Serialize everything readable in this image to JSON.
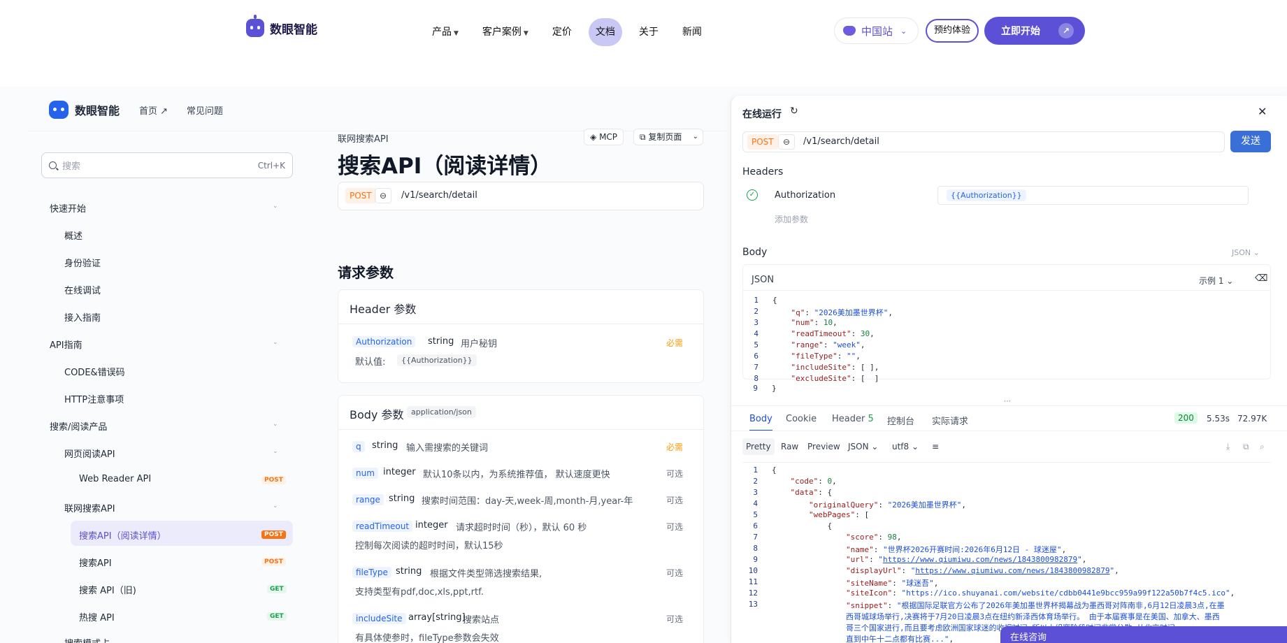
{
  "topnav": {
    "brand": "数眼智能",
    "items": [
      "产品",
      "客户案例",
      "定价",
      "文档",
      "关于",
      "新闻"
    ],
    "active": "文档",
    "site": "中国站",
    "demo": "预约体验",
    "start": "立即开始"
  },
  "docheader": {
    "brand": "数眼智能",
    "home": "首页 ↗",
    "faq": "常见问题"
  },
  "search": {
    "placeholder": "搜索",
    "shortcut": "Ctrl+K"
  },
  "sidebar": {
    "quick": "快速开始",
    "overview": "概述",
    "auth": "身份验证",
    "online": "在线调试",
    "guide": "接入指南",
    "apiguide": "API指南",
    "codes": "CODE&错误码",
    "http": "HTTP注意事项",
    "product": "搜索/阅读产品",
    "webread": "网页阅读API",
    "webreader": "Web Reader API",
    "netsearch": "联网搜索API",
    "detail": "搜索API（阅读详情）",
    "searchapi": "搜索API",
    "searchold": "搜索 API（旧)",
    "hot": "热搜 API",
    "more": "搜索模式占",
    "post": "POST",
    "get": "GET"
  },
  "main": {
    "crumb": "联网搜索API",
    "mcp": "MCP",
    "copy": "复制页面",
    "title": "搜索API（阅读详情）",
    "method": "POST",
    "endpoint": "/v1/search/detail",
    "reqparams": "请求参数",
    "headerparams": "Header 参数",
    "auth_name": "Authorization",
    "auth_type": "string",
    "auth_desc": "用户秘钥",
    "required": "必需",
    "optional": "可选",
    "default_label": "默认值:",
    "default_val": "{{Authorization}}",
    "bodyparams": "Body 参数",
    "content_type": "application/json",
    "params": [
      {
        "name": "q",
        "type": "string",
        "desc": "输入需搜索的关键词",
        "req": "必需"
      },
      {
        "name": "num",
        "type": "integer",
        "desc": "默认10条以内，为系统推荐值， 默认速度更快",
        "req": "可选"
      },
      {
        "name": "range",
        "type": "string",
        "desc": "搜索时间范围：day-天,week-周,month-月,year-年",
        "req": "可选"
      },
      {
        "name": "readTimeout",
        "type": "integer",
        "desc": "请求超时时间（秒），默认 60 秒",
        "desc2": "控制每次阅读的超时时间，默认15秒",
        "req": "可选"
      },
      {
        "name": "fileType",
        "type": "string",
        "desc": "根据文件类型筛选搜索结果,",
        "desc2": "支持类型有pdf,doc,xls,ppt,rtf.",
        "req": "可选"
      },
      {
        "name": "includeSite",
        "type": "array[string]",
        "desc": "搜索站点",
        "desc2": "有具体使参时，fileType参数会失效",
        "req": "可选"
      }
    ]
  },
  "panel": {
    "title": "在线运行",
    "method": "POST",
    "endpoint": "/v1/search/detail",
    "send": "发送",
    "headers": "Headers",
    "hname": "Authorization",
    "hval": "{{Authorization}}",
    "addparam": "添加参数",
    "body": "Body",
    "json": "JSON",
    "example": "示例 1",
    "tabs": [
      "Body",
      "Cookie",
      "Header",
      "控制台",
      "实际请求"
    ],
    "header_count": "5",
    "status": "200",
    "time": "5.53s",
    "size": "72.97K",
    "views": [
      "Pretty",
      "Raw",
      "Preview"
    ],
    "fmt": "JSON",
    "enc": "utf8",
    "consult": "在线咨询"
  }
}
